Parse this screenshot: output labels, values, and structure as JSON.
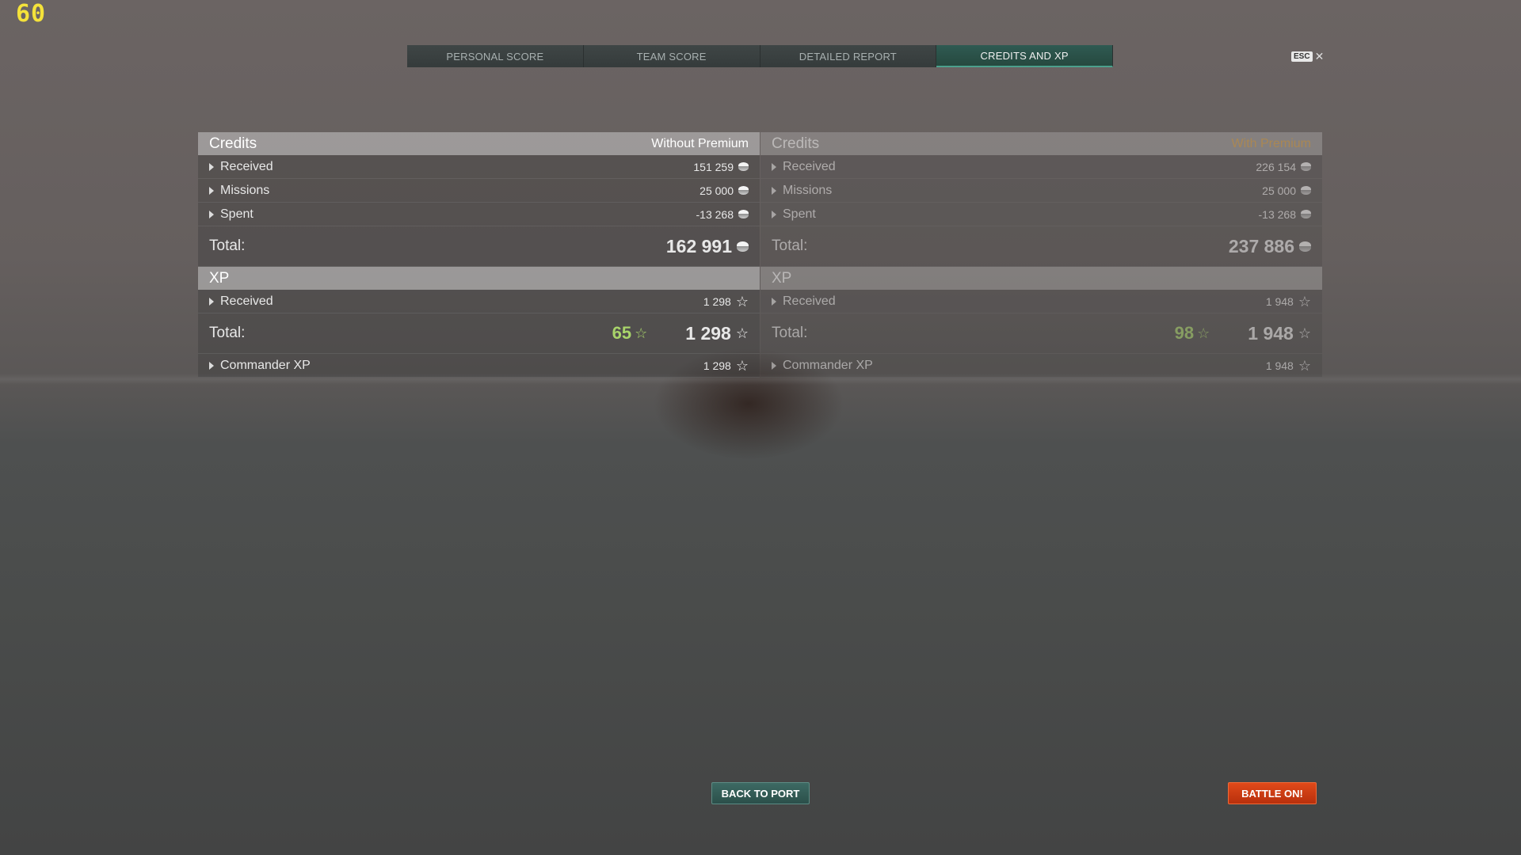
{
  "fps": "60",
  "tabs": [
    {
      "label": "PERSONAL SCORE"
    },
    {
      "label": "TEAM SCORE"
    },
    {
      "label": "DETAILED REPORT"
    },
    {
      "label": "CREDITS AND XP",
      "active": true
    }
  ],
  "esc": {
    "key": "ESC",
    "close": "✕"
  },
  "without_premium": {
    "credits": {
      "title": "Credits",
      "tag": "Without Premium",
      "rows": [
        {
          "label": "Received",
          "value": "151 259"
        },
        {
          "label": "Missions",
          "value": "25 000"
        },
        {
          "label": "Spent",
          "value": "-13 268"
        }
      ],
      "total_label": "Total:",
      "total_value": "162 991"
    },
    "xp": {
      "title": "XP",
      "received_label": "Received",
      "received_value": "1 298",
      "total_label": "Total:",
      "bonus_value": "65",
      "total_value": "1 298",
      "commander_label": "Commander XP",
      "commander_value": "1 298"
    }
  },
  "with_premium": {
    "credits": {
      "title": "Credits",
      "tag": "With Premium",
      "rows": [
        {
          "label": "Received",
          "value": "226 154"
        },
        {
          "label": "Missions",
          "value": "25 000"
        },
        {
          "label": "Spent",
          "value": "-13 268"
        }
      ],
      "total_label": "Total:",
      "total_value": "237 886"
    },
    "xp": {
      "title": "XP",
      "received_label": "Received",
      "received_value": "1 948",
      "total_label": "Total:",
      "bonus_value": "98",
      "total_value": "1 948",
      "commander_label": "Commander XP",
      "commander_value": "1 948"
    }
  },
  "buttons": {
    "back_to_port": "BACK TO PORT",
    "battle_on": "BATTLE ON!"
  },
  "colors": {
    "premium_tag": "#e0a64a",
    "bonus_green": "#a8d46a",
    "active_tab": "#2f5a52",
    "battle_button": "#d03e14"
  }
}
